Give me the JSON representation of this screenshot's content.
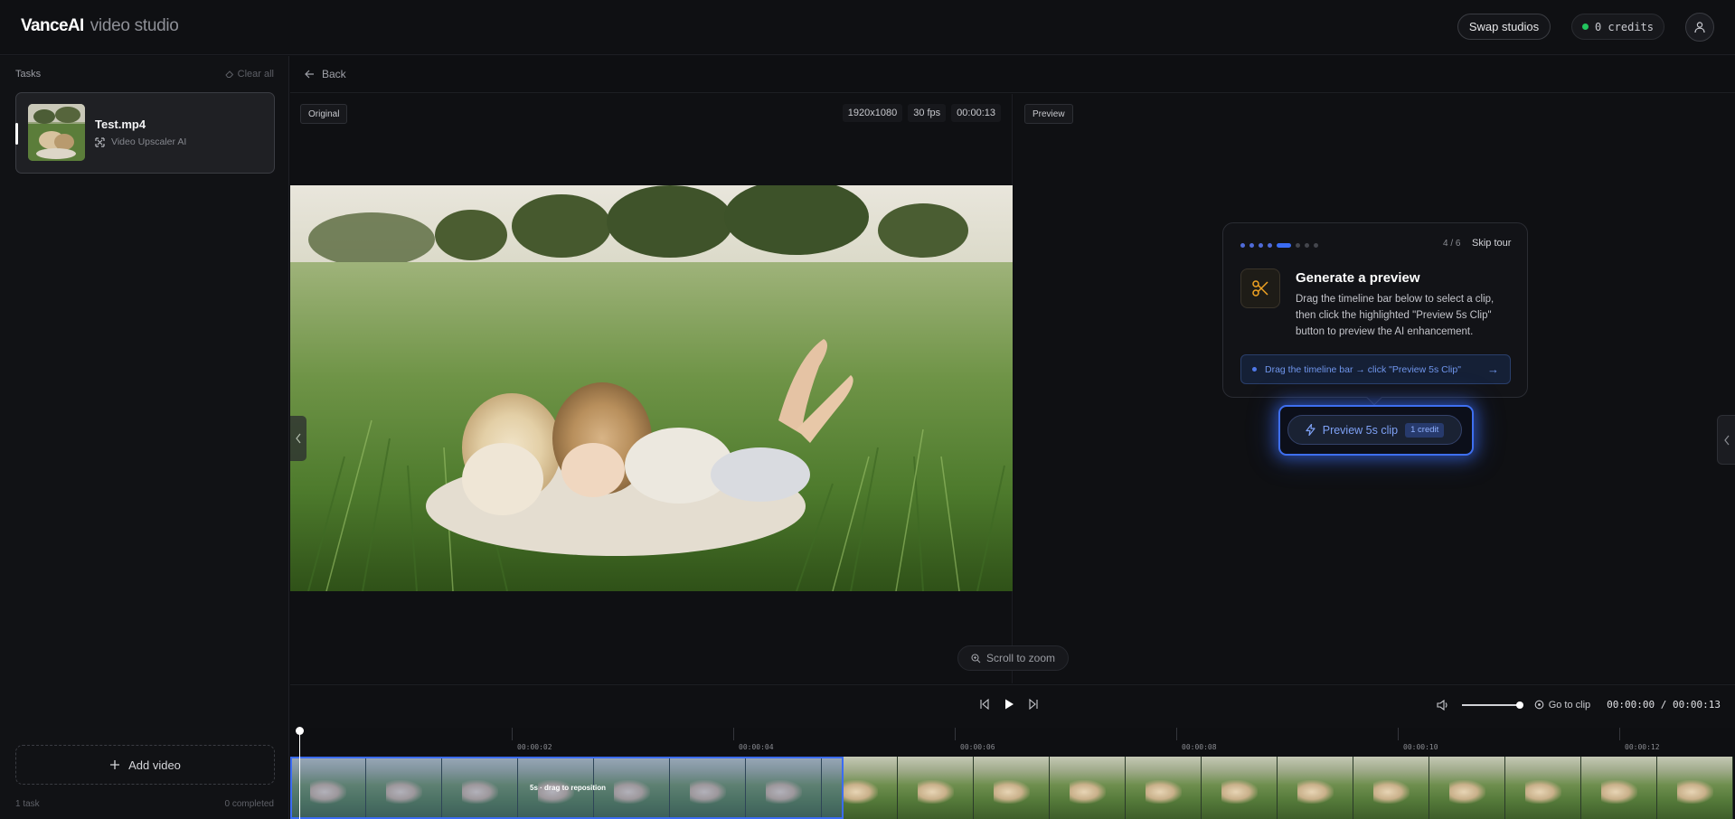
{
  "header": {
    "brand_name": "VanceAI",
    "brand_sub": "video studio",
    "swap_label": "Swap studios",
    "credits_label": "0 credits"
  },
  "sidebar": {
    "title": "Tasks",
    "clear_all": "Clear all",
    "task": {
      "name": "Test.mp4",
      "tool": "Video Upscaler AI"
    },
    "add_video": "Add video",
    "footer_left": "1 task",
    "footer_right": "0 completed"
  },
  "main": {
    "back": "Back",
    "original_tag": "Original",
    "preview_tag": "Preview",
    "meta": {
      "resolution": "1920x1080",
      "fps": "30 fps",
      "duration": "00:00:13"
    },
    "scroll_zoom": "Scroll to zoom"
  },
  "tour": {
    "step": "4 / 6",
    "skip": "Skip tour",
    "title": "Generate a preview",
    "body": "Drag the timeline bar below to select a clip, then click the highlighted \"Preview 5s Clip\" button to preview the AI enhancement.",
    "hint": "Drag the timeline bar → click \"Preview 5s Clip\"",
    "hint_arrow": "→",
    "total_steps": 6,
    "current_step": 4
  },
  "preview_button": {
    "label": "Preview 5s clip",
    "credit": "1 credit"
  },
  "controls": {
    "go_to_clip": "Go to clip",
    "time": "00:00:00 / 00:00:13",
    "volume": 1.0
  },
  "timeline": {
    "ticks": [
      "00:00:02",
      "00:00:04",
      "00:00:06",
      "00:00:08",
      "00:00:10",
      "00:00:12"
    ],
    "selection_label": "5s · drag to reposition",
    "frame_count": 19
  },
  "colors": {
    "accent": "#3b6cf3",
    "credit_dot": "#22c55e",
    "tour_icon": "#f0a323"
  }
}
